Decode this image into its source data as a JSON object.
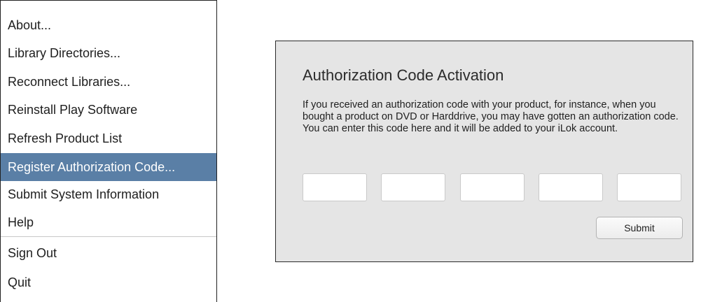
{
  "menu": {
    "items": [
      {
        "label": "About..."
      },
      {
        "label": "Library Directories..."
      },
      {
        "label": "Reconnect Libraries..."
      },
      {
        "label": "Reinstall Play Software"
      },
      {
        "label": "Refresh Product List"
      },
      {
        "label": "Register Authorization Code...",
        "selected": true
      },
      {
        "label": "Submit System Information"
      },
      {
        "label": "Help"
      },
      {
        "label": "Sign Out"
      },
      {
        "label": "Quit"
      }
    ],
    "selected_color": "#5a7fa6"
  },
  "activation": {
    "title": "Authorization Code Activation",
    "description": "If you received an authorization code with your product, for instance, when you bought a product on DVD or Harddrive, you may have gotten an authorization code. You can enter this code here and it will be added to your iLok account.",
    "code_fields": [
      "",
      "",
      "",
      "",
      ""
    ],
    "submit_label": "Submit"
  }
}
